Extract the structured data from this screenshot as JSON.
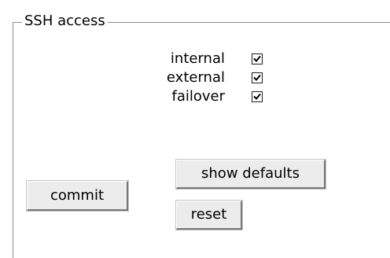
{
  "group": {
    "legend": "SSH access",
    "options": [
      {
        "label": "internal",
        "checked": true
      },
      {
        "label": "external",
        "checked": true
      },
      {
        "label": "failover",
        "checked": true
      }
    ]
  },
  "buttons": {
    "commit": "commit",
    "show_defaults": "show defaults",
    "reset": "reset"
  },
  "colors": {
    "group_border": "#8c8c8c",
    "button_face": "#ececec",
    "checkbox_border": "#1c1c1c"
  }
}
